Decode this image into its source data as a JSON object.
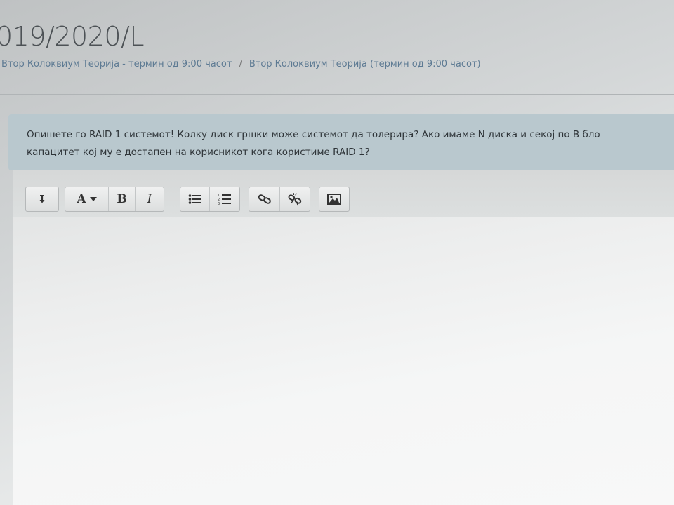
{
  "page": {
    "course_title": "019/2020/L"
  },
  "breadcrumb": {
    "items": [
      "Втор Колоквиум Теорија - термин од 9:00 часот",
      "Втор Колоквиум Теорија (термин од 9:00 часот)"
    ],
    "separator": "/"
  },
  "question": {
    "line1": "Опишете го RAID 1 системот! Колку диск гршки може системот да толерира?  Ако имаме  N диска и секој по B бло",
    "line2": "капацитет кој му е достапен на корисникот кога користиме RAID 1?"
  },
  "toolbar": {
    "expand_icon": "arrow-down-icon",
    "font_label": "A",
    "bold_label": "B",
    "italic_label": "I",
    "unordered_list_icon": "unordered-list-icon",
    "ordered_list_icon": "ordered-list-icon",
    "link_icon": "link-icon",
    "unlink_icon": "unlink-icon",
    "image_icon": "image-icon"
  },
  "editor": {
    "content": ""
  }
}
